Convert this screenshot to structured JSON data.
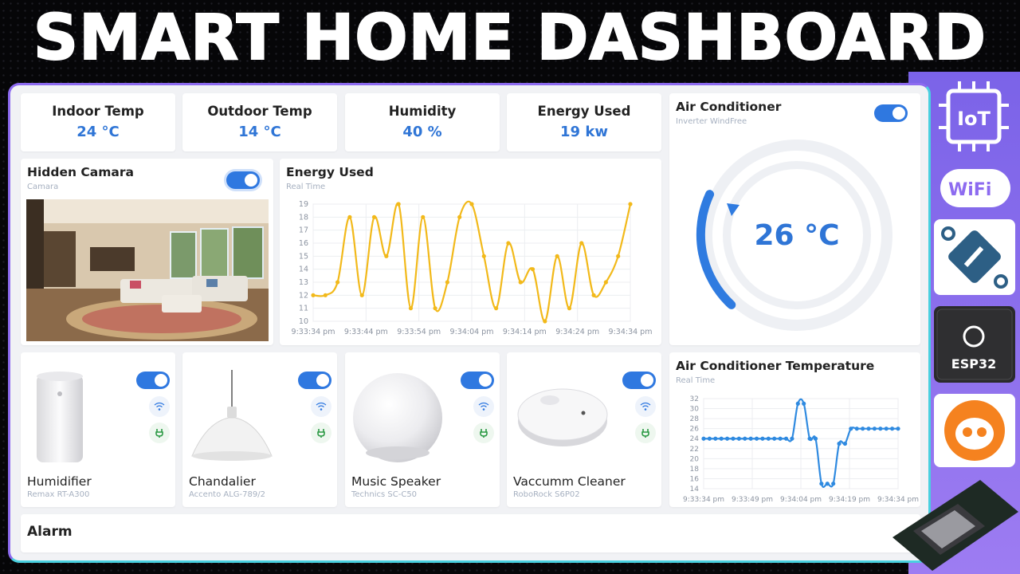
{
  "banner": {
    "title": "SMART HOME DASHBOARD"
  },
  "stats": [
    {
      "label": "Indoor Temp",
      "value": "24 °C"
    },
    {
      "label": "Outdoor Temp",
      "value": "14 °C"
    },
    {
      "label": "Humidity",
      "value": "40 %"
    },
    {
      "label": "Energy Used",
      "value": "19 kw"
    }
  ],
  "camera": {
    "title": "Hidden Camara",
    "subtitle": "Camara",
    "enabled": true
  },
  "energy_chart": {
    "title": "Energy Used",
    "subtitle": "Real Time"
  },
  "ac": {
    "title": "Air Conditioner",
    "subtitle": "Inverter WindFree",
    "temperature": "26 °C",
    "enabled": true
  },
  "ac_chart": {
    "title": "Air Conditioner Temperature",
    "subtitle": "Real Time"
  },
  "devices": [
    {
      "name": "Humidifier",
      "model": "Remax RT-A300",
      "enabled": true
    },
    {
      "name": "Chandalier",
      "model": "Accento ALG-789/2",
      "enabled": true
    },
    {
      "name": "Music Speaker",
      "model": "Technics SC-C50",
      "enabled": true
    },
    {
      "name": "Vaccumm Cleaner",
      "model": "RoboRock S6P02",
      "enabled": true
    }
  ],
  "alarm": {
    "title": "Alarm"
  },
  "sidebar_logos": [
    {
      "icon": "iot-chip-icon",
      "text": "IoT"
    },
    {
      "icon": "wifi-logo-icon",
      "text": "WiFi"
    },
    {
      "icon": "platform-bug-icon",
      "text": ""
    },
    {
      "icon": "esp32-chip-icon",
      "text": "ESP32"
    },
    {
      "icon": "platformio-alien-icon",
      "text": ""
    }
  ],
  "colors": {
    "accent": "#2f78e0",
    "energy_line": "#f2b91a",
    "ac_line": "#2f8ae0",
    "dash_border": "#8d6bf0",
    "purple_bg": "#8a6ef0"
  },
  "chart_data": [
    {
      "type": "line",
      "title": "Energy Used",
      "subtitle": "Real Time",
      "x": [
        "9:33:34 pm",
        "9:33:44 pm",
        "9:33:54 pm",
        "9:34:04 pm",
        "9:34:14 pm",
        "9:34:24 pm",
        "9:34:34 pm"
      ],
      "series": [
        {
          "values": [
            12,
            12,
            13,
            18,
            12,
            18,
            15,
            19,
            11,
            18,
            11,
            13,
            18,
            19,
            15,
            11,
            16,
            13,
            14,
            10,
            15,
            11,
            16,
            12,
            13,
            15,
            19
          ]
        }
      ],
      "ylim": [
        10,
        19
      ],
      "yticks": [
        10,
        11,
        12,
        13,
        14,
        15,
        16,
        17,
        18,
        19
      ],
      "grid": true
    },
    {
      "type": "line",
      "title": "Air Conditioner Temperature",
      "subtitle": "Real Time",
      "x": [
        "9:33:34 pm",
        "9:33:49 pm",
        "9:34:04 pm",
        "9:34:19 pm",
        "9:34:34 pm"
      ],
      "series": [
        {
          "values": [
            24,
            24,
            24,
            24,
            24,
            24,
            24,
            24,
            24,
            24,
            24,
            24,
            24,
            24,
            24,
            24,
            31,
            31,
            24,
            24,
            15,
            15,
            15,
            23,
            23,
            26,
            26,
            26,
            26,
            26,
            26,
            26,
            26,
            26
          ]
        }
      ],
      "ylim": [
        14,
        32
      ],
      "yticks": [
        14,
        16,
        18,
        20,
        22,
        24,
        26,
        28,
        30,
        32
      ],
      "grid": true
    }
  ]
}
